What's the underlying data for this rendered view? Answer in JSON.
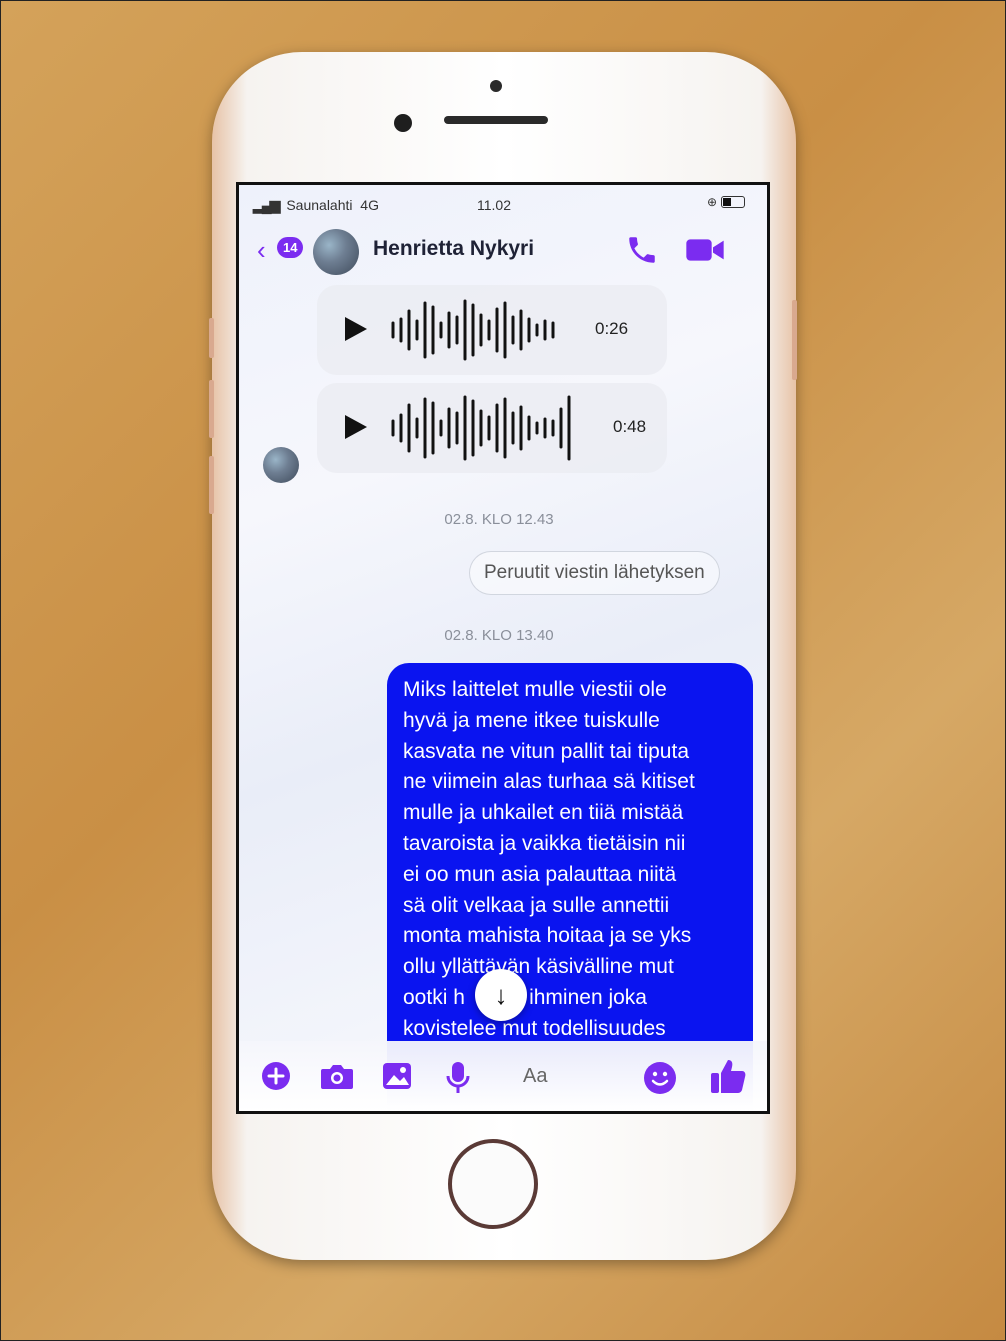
{
  "status_bar": {
    "signal": "▂▄▆",
    "carrier": "Saunalahti",
    "network": "4G",
    "time": "11.02"
  },
  "header": {
    "back_icon": "chevron-left-icon",
    "unread_count": "14",
    "contact_name": "Henrietta Nykyri",
    "call_icon": "phone-icon",
    "video_icon": "video-camera-icon",
    "accent_color": "#7b2cf0"
  },
  "voice_messages": [
    {
      "duration": "0:26"
    },
    {
      "duration": "0:48"
    }
  ],
  "timestamps": {
    "first": "02.8. KLO 12.43",
    "second": "02.8. KLO 13.40"
  },
  "unsent_notice": "Peruutit viestin lähetyksen",
  "message": {
    "bubble_color": "#0a14f0",
    "lines": [
      "Miks laittelet mulle viestii ole",
      "hyvä ja mene itkee tuiskulle",
      "kasvata ne vitun pallit tai tiputa",
      "ne viimein alas turhaa sä kitiset",
      "mulle ja uhkailet en tiiä mistää",
      "tavaroista ja vaikka tietäisin nii",
      "ei oo mun asia palauttaa niitä",
      "sä olit velkaa ja sulle annettii",
      "monta mahista hoitaa ja se yks",
      "ollu yllättävän käsivälline mut",
      "ootki h    öpö ihminen joka",
      "kovistelee mut todellisuudes"
    ]
  },
  "scroll_button_icon": "arrow-down-icon",
  "composer": {
    "placeholder": "Aa",
    "icons": [
      "plus-icon",
      "camera-icon",
      "image-icon",
      "microphone-icon",
      "emoji-icon",
      "thumbs-up-icon"
    ]
  }
}
